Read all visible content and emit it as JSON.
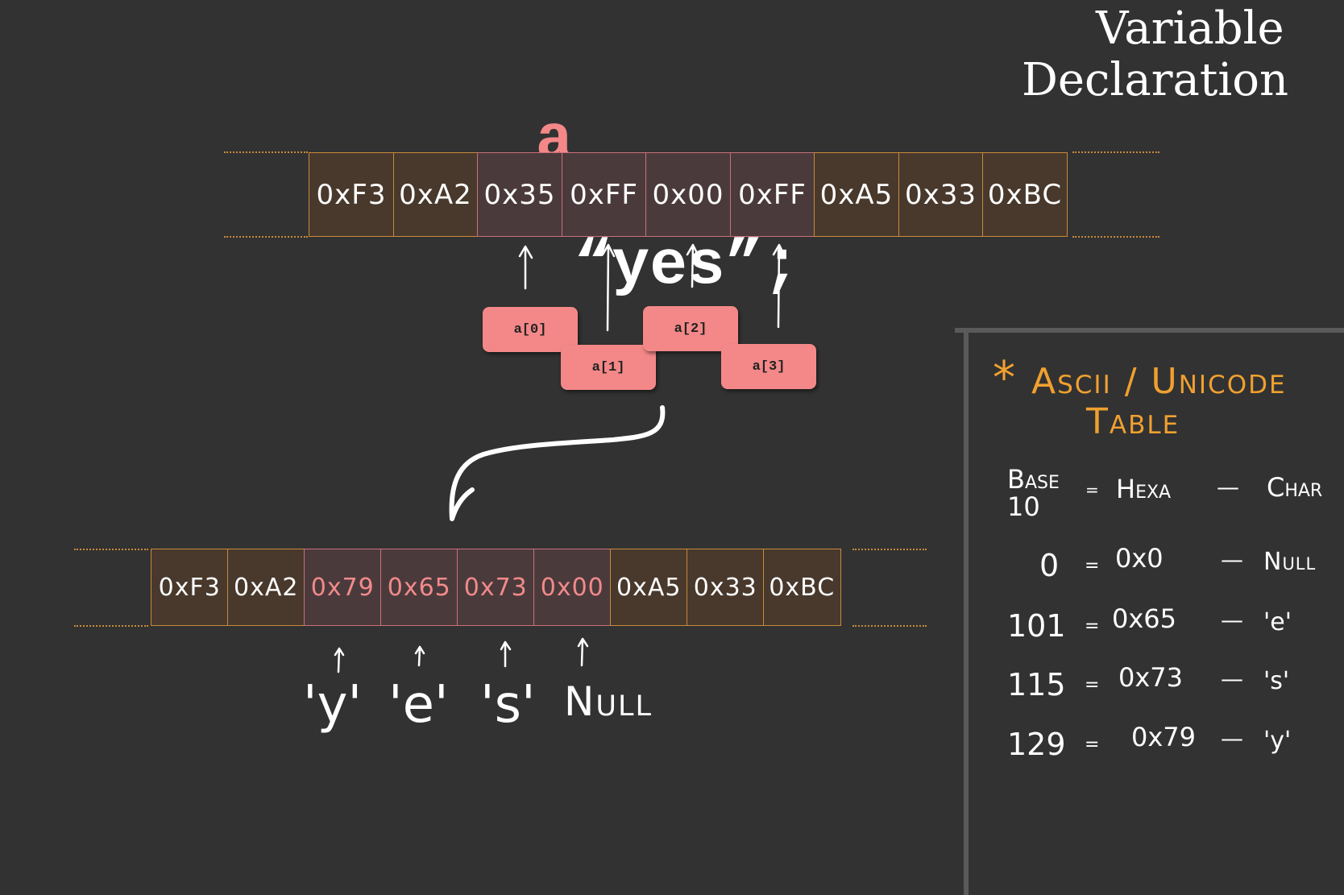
{
  "code": {
    "variable": "a",
    "equals": "=",
    "value": "“yes”;"
  },
  "corner_title": {
    "line1": "Variable",
    "line2": "Declaration"
  },
  "memory_top": [
    {
      "value": "0xF3",
      "highlight": false
    },
    {
      "value": "0xA2",
      "highlight": false
    },
    {
      "value": "0x35",
      "highlight": true
    },
    {
      "value": "0xFF",
      "highlight": true
    },
    {
      "value": "0x00",
      "highlight": true
    },
    {
      "value": "0xFF",
      "highlight": true
    },
    {
      "value": "0xA5",
      "highlight": false
    },
    {
      "value": "0x33",
      "highlight": false
    },
    {
      "value": "0xBC",
      "highlight": false
    }
  ],
  "index_labels": [
    "a[0]",
    "a[1]",
    "a[2]",
    "a[3]"
  ],
  "memory_bottom": [
    {
      "value": "0xF3",
      "highlight": false
    },
    {
      "value": "0xA2",
      "highlight": false
    },
    {
      "value": "0x79",
      "highlight": true
    },
    {
      "value": "0x65",
      "highlight": true
    },
    {
      "value": "0x73",
      "highlight": true
    },
    {
      "value": "0x00",
      "highlight": true
    },
    {
      "value": "0xA5",
      "highlight": false
    },
    {
      "value": "0x33",
      "highlight": false
    },
    {
      "value": "0xBC",
      "highlight": false
    }
  ],
  "char_labels": [
    "'y'",
    "'e'",
    "'s'",
    "Null"
  ],
  "ascii_table": {
    "star": "*",
    "title_line1": "Ascii / Unicode",
    "title_line2": "Table",
    "headers": {
      "base10": "Base 10",
      "eq": "=",
      "hexa": "Hexa",
      "dash": "—",
      "char": "Char"
    },
    "rows": [
      {
        "dec": "0",
        "hex": "0x0",
        "char": "Null"
      },
      {
        "dec": "101",
        "hex": "0x65",
        "char": "'e'"
      },
      {
        "dec": "115",
        "hex": "0x73",
        "char": "'s'"
      },
      {
        "dec": "129",
        "hex": "0x79",
        "char": "'y'"
      }
    ]
  },
  "colors": {
    "background": "#323232",
    "variable": "#f48888",
    "cell_border": "#c88a3a",
    "highlight_border": "#c9707a",
    "label_box": "#f48888",
    "table_title": "#f0a030",
    "hex_highlight": "#f28a8a",
    "panel_border": "#5a5a5a"
  }
}
